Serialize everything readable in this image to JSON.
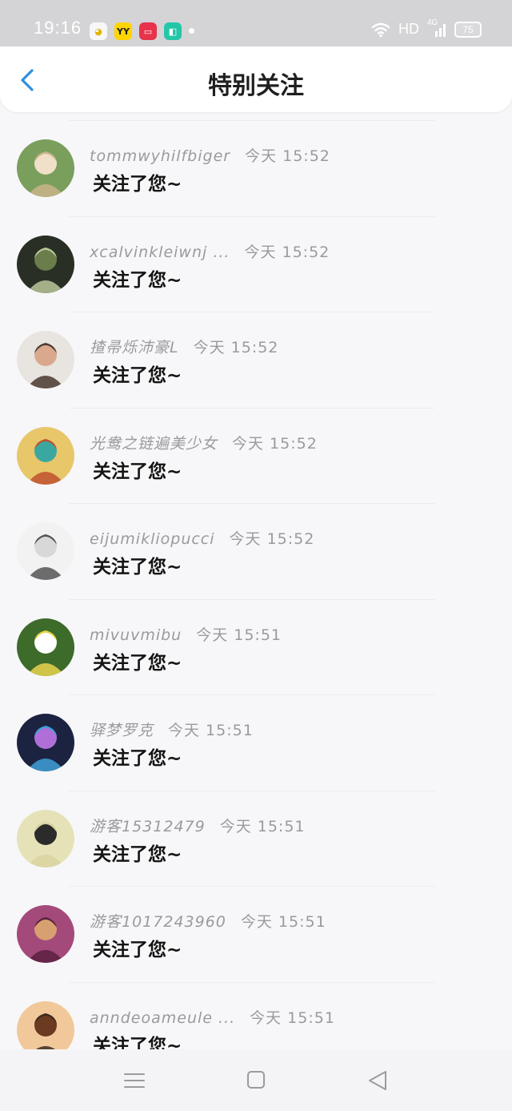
{
  "status_bar": {
    "time": "19:16",
    "apps": [
      {
        "icon": "app-icon-pikachu",
        "glyph": "◕",
        "bg": "#f7f7f7",
        "fg": "#e2b400"
      },
      {
        "icon": "app-icon-yy",
        "glyph": "YY",
        "bg": "#ffd400",
        "fg": "#1b1b1b"
      },
      {
        "icon": "app-icon-video",
        "glyph": "▭",
        "bg": "#e8334a",
        "fg": "#ffffff"
      },
      {
        "icon": "app-icon-green",
        "glyph": "◧",
        "bg": "#23c7a8",
        "fg": "#ffffff"
      }
    ],
    "network_label": "HD",
    "signal_label": "4G",
    "battery": "75"
  },
  "header": {
    "title": "特别关注"
  },
  "list": {
    "items": [
      {
        "name": "tommwyhilfbiger",
        "time": "今天 15:52",
        "message": "关注了您~",
        "avatar": {
          "bg": "#7a9e5c",
          "accent": "#f0e0c8",
          "hair": "#c9b48a"
        }
      },
      {
        "name": "xcalvinkleiwnj ...",
        "time": "今天 15:52",
        "message": "关注了您~",
        "avatar": {
          "bg": "#2a2f26",
          "accent": "#6a7d4a",
          "hair": "#b9c79a"
        }
      },
      {
        "name": "揸帚烁沛豪L",
        "time": "今天 15:52",
        "message": "关注了您~",
        "avatar": {
          "bg": "#e8e4df",
          "accent": "#d9a88d",
          "hair": "#4a3a30"
        }
      },
      {
        "name": "光鸯之链遍美少女",
        "time": "今天 15:52",
        "message": "关注了您~",
        "avatar": {
          "bg": "#e8c66a",
          "accent": "#3aa7a0",
          "hair": "#c0502e"
        }
      },
      {
        "name": "eijumikliopucci",
        "time": "今天 15:52",
        "message": "关注了您~",
        "avatar": {
          "bg": "#f2f2f2",
          "accent": "#d8d8d8",
          "hair": "#555555"
        }
      },
      {
        "name": "mivuvmibu",
        "time": "今天 15:51",
        "message": "关注了您~",
        "avatar": {
          "bg": "#3d6b2a",
          "accent": "#ffffff",
          "hair": "#e9d44c"
        }
      },
      {
        "name": "驿梦罗克",
        "time": "今天 15:51",
        "message": "关注了您~",
        "avatar": {
          "bg": "#1c2340",
          "accent": "#b06fd8",
          "hair": "#3fa0d8"
        }
      },
      {
        "name": "游客15312479",
        "time": "今天 15:51",
        "message": "关注了您~",
        "avatar": {
          "bg": "#e6e2b8",
          "accent": "#2b2b2b",
          "hair": "#d8d4a0"
        }
      },
      {
        "name": "游客1017243960",
        "time": "今天 15:51",
        "message": "关注了您~",
        "avatar": {
          "bg": "#a44a7a",
          "accent": "#d8a070",
          "hair": "#5a2040"
        }
      },
      {
        "name": "anndeoameule ...",
        "time": "今天 15:51",
        "message": "关注了您~",
        "avatar": {
          "bg": "#f1c89a",
          "accent": "#6b3a20",
          "hair": "#3a2a20"
        }
      }
    ]
  },
  "nav_bar": {
    "menu": "menu-icon",
    "home": "home-icon",
    "back": "back-icon"
  }
}
